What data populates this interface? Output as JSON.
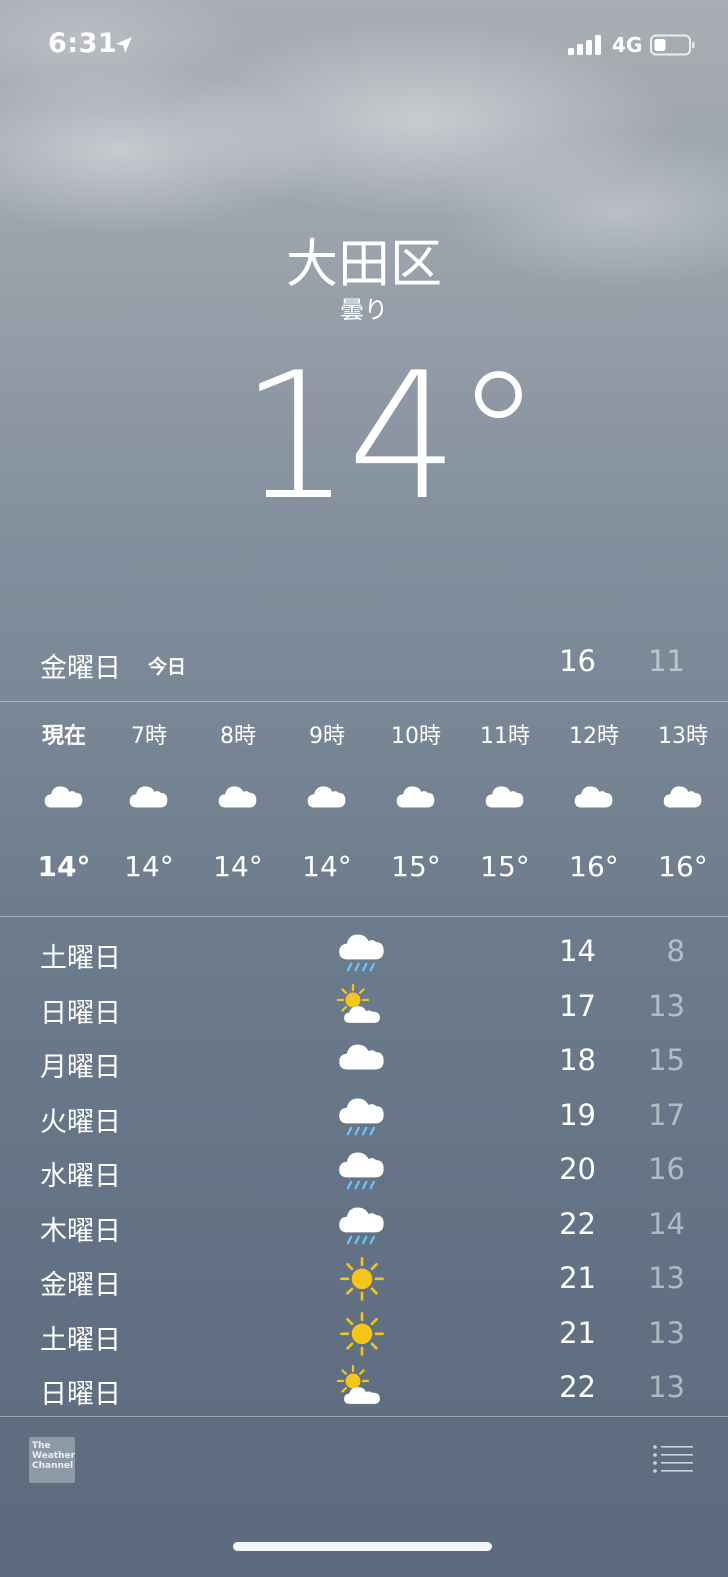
{
  "status": {
    "time": "6:31",
    "network": "4G"
  },
  "header": {
    "city": "大田区",
    "condition": "曇り",
    "temperature": "14°"
  },
  "today": {
    "day": "金曜日",
    "tag": "今日",
    "high": "16",
    "low": "11"
  },
  "hourly": [
    {
      "label": "現在",
      "icon": "cloud-icon",
      "temp": "14°"
    },
    {
      "label": "7時",
      "icon": "cloud-icon",
      "temp": "14°"
    },
    {
      "label": "8時",
      "icon": "cloud-icon",
      "temp": "14°"
    },
    {
      "label": "9時",
      "icon": "cloud-icon",
      "temp": "14°"
    },
    {
      "label": "10時",
      "icon": "cloud-icon",
      "temp": "15°"
    },
    {
      "label": "11時",
      "icon": "cloud-icon",
      "temp": "15°"
    },
    {
      "label": "12時",
      "icon": "cloud-icon",
      "temp": "16°"
    },
    {
      "label": "13時",
      "icon": "cloud-icon",
      "temp": "16°"
    }
  ],
  "daily": [
    {
      "day": "土曜日",
      "icon": "rain-icon",
      "high": "14",
      "low": "8"
    },
    {
      "day": "日曜日",
      "icon": "partly-sunny-icon",
      "high": "17",
      "low": "13"
    },
    {
      "day": "月曜日",
      "icon": "cloud-icon",
      "high": "18",
      "low": "15"
    },
    {
      "day": "火曜日",
      "icon": "rain-icon",
      "high": "19",
      "low": "17"
    },
    {
      "day": "水曜日",
      "icon": "rain-icon",
      "high": "20",
      "low": "16"
    },
    {
      "day": "木曜日",
      "icon": "rain-icon",
      "high": "22",
      "low": "14"
    },
    {
      "day": "金曜日",
      "icon": "sun-icon",
      "high": "21",
      "low": "13"
    },
    {
      "day": "土曜日",
      "icon": "sun-icon",
      "high": "21",
      "low": "13"
    },
    {
      "day": "日曜日",
      "icon": "partly-sunny-icon",
      "high": "22",
      "low": "13"
    }
  ],
  "footer": {
    "logo_text": "The Weather Channel"
  },
  "colors": {
    "sun": "#f5c518",
    "rain": "#6ec6ff",
    "cloud": "#ffffff"
  }
}
